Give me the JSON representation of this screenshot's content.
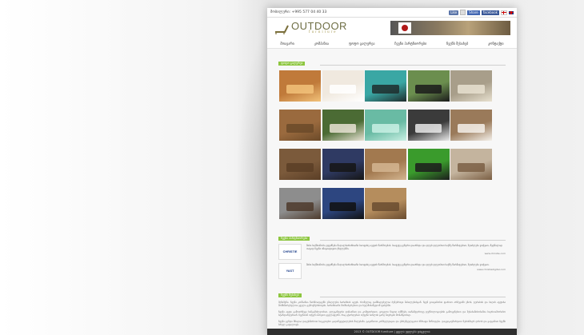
{
  "topbar": {
    "phone": "მობილური: +995 577 04 40 33",
    "like_label": "Like",
    "share_label": "Share",
    "facebook_label": "facebook"
  },
  "logo": {
    "title": "OUTDOOR",
    "subtitle": "furniture"
  },
  "nav": {
    "items": [
      "მთავარი",
      "კომპანია",
      "ფოტო გალერეა",
      "ჩვენი პარტნიორები",
      "ჩვენს შესახებ",
      "კონტაქტი"
    ]
  },
  "gallery": {
    "label": "ფოტო გალერეა",
    "photos": [
      {
        "name": "teak-dining-set",
        "bg": "#c07a3a",
        "accent": "#f2c27a"
      },
      {
        "name": "white-daybed",
        "bg": "#f0e9df",
        "accent": "#ffffff"
      },
      {
        "name": "pool-table-set",
        "bg": "#3aa7a4",
        "accent": "#1f2d2d"
      },
      {
        "name": "black-chairs-set",
        "bg": "#6b8e4e",
        "accent": "#1b1b1b"
      },
      {
        "name": "rattan-sofa",
        "bg": "#a89e8a",
        "accent": "#e8e1d0"
      },
      {
        "name": "wooden-bench",
        "bg": "#9a6a3e",
        "accent": "#6b4a29"
      },
      {
        "name": "white-sofa-set",
        "bg": "#4b6b34",
        "accent": "#e8e2d4"
      },
      {
        "name": "glass-table",
        "bg": "#69bba4",
        "accent": "#c9f0e4"
      },
      {
        "name": "dining-table",
        "bg": "#3b3b3b",
        "accent": "#e9e9e9"
      },
      {
        "name": "white-chaise",
        "bg": "#9a7a5a",
        "accent": "#f4f0ea"
      },
      {
        "name": "brown-sectional",
        "bg": "#7b5a3b",
        "accent": "#5a3e26"
      },
      {
        "name": "blue-lounge",
        "bg": "#2f3a63",
        "accent": "#151515"
      },
      {
        "name": "wood-table-set",
        "bg": "#a2794f",
        "accent": "#d3b590"
      },
      {
        "name": "green-lawn-set",
        "bg": "#3a9b2c",
        "accent": "#1c1c1c"
      },
      {
        "name": "beige-sectional",
        "bg": "#c4b49e",
        "accent": "#7b5f44"
      },
      {
        "name": "round-seats",
        "bg": "#8d8d8d",
        "accent": "#4d3a2c"
      },
      {
        "name": "fountain-lounge",
        "bg": "#2d4680",
        "accent": "#111111"
      },
      {
        "name": "bamboo-set",
        "bg": "#b58d5d",
        "accent": "#6a4c30"
      }
    ]
  },
  "partners": {
    "label": "ჩვენი პარტნიორები",
    "items": [
      {
        "logo": "CHRISTIE",
        "text": "მისი საქმიანობა ეფუძნება მაღალხარისხიანი საოფისე ავეჯის წარმოებას. საავეჯე ცენტრი დაარსდა და დღეს დღეობით საქმე წარმატებით, შეიძლება ვთქვათ, მეტწილად თავად ჩვენი ინიციატივით ქსელებში.",
        "url": "www.christie.com"
      },
      {
        "logo": "YAST",
        "text": "მისი საქმიანობა ეფუძნება მაღალხარისხიანი საოფისე ავეჯის წარმოებას. საავეჯე ცენტრი დაარსდა და დღეს დღეობით საქმე წარმატებით, შეიძლება ვთქვათ.",
        "url": "www.christiedigital.com"
      }
    ]
  },
  "about": {
    "label": "ჩვენს შესახებ",
    "paragraphs": [
      "შენიშვნა: ჩვენი კომპანია წარმოადგენს უმაღლესი ხარისხის ავეჯს, რომელიც დამზადებულია ბუნებრივი მასალებისგან. ჩვენ ვთავაზობთ ფართო არჩევანს ეზოს, ტერასის და ბაღის ავეჯისა მომხმარებელთა ყველა გემოვნებისთვის, ხარისხიანი მომსახურებით და ხელმისაწვდომ ფასებში.",
      "ჩვენი ავეჯი გამოირჩევა ხანგამძლეობით, ელეგანტური დიზაინით და კომფორტით. ყოველი ნივთი იქმნება თანამედროვე ტექნოლოგიების გამოყენებით და შესაბამისობაშია საერთაშორისო სტანდარტებთან. ჩვენთან თქვენ იპოვით ყველაფერს, რაც გჭირდებათ თქვენი სახლის გარე სივრცის მოსაწყობად.",
      "ჩვენი გუნდი მზადაა დაგეხმაროთ საუკეთესო გადაწყვეტილების მიღებაში, გაგიწიოთ კონსულტაცია და უზრუნველგყოთ სწრაფი მიწოდება. დაგვიკავშირდით ნებისმიერ დროს და გაეცანით ჩვენს სრულ კატალოგს."
    ]
  },
  "footer": {
    "text": "2013 © OUTDOOR furniture | ყველა უფლება დაცულია"
  }
}
